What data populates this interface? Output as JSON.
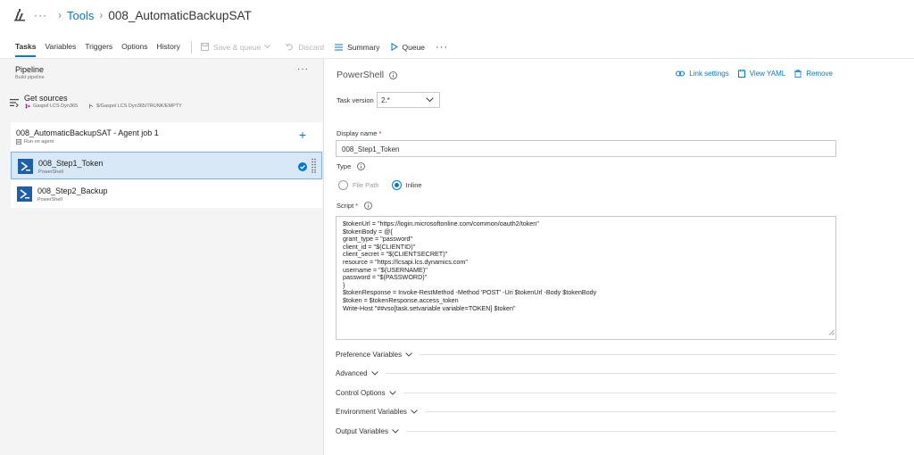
{
  "breadcrumb": {
    "logo_icon": "build-pipeline-icon",
    "ellipsis": "···",
    "parent": "Tools",
    "current": "008_AutomaticBackupSAT"
  },
  "toolbar": {
    "tabs": [
      "Tasks",
      "Variables",
      "Triggers",
      "Options",
      "History"
    ],
    "active_tab": "Tasks",
    "save_queue": "Save & queue",
    "discard": "Discard",
    "summary": "Summary",
    "queue": "Queue",
    "more": "···"
  },
  "pipeline": {
    "title": "Pipeline",
    "subtitle": "Build pipeline",
    "more": "···"
  },
  "get_sources": {
    "title": "Get sources",
    "repo": "Gaspol LCS Dyn365",
    "path": "$/Gaspol LCS Dyn365/TRUNK/EMPTY"
  },
  "agent_job": {
    "title": "008_AutomaticBackupSAT - Agent job 1",
    "subtitle": "Run on agent",
    "add": "+"
  },
  "tasks": [
    {
      "title": "008_Step1_Token",
      "subtitle": "PowerShell",
      "selected": true
    },
    {
      "title": "008_Step2_Backup",
      "subtitle": "PowerShell",
      "selected": false
    }
  ],
  "details": {
    "title": "PowerShell",
    "link_settings": "Link settings",
    "view_yaml": "View YAML",
    "remove": "Remove",
    "task_version_label": "Task version",
    "task_version_value": "2.*",
    "display_name_label": "Display name",
    "display_name_value": "008_Step1_Token",
    "type_label": "Type",
    "type_file_path": "File Path",
    "type_inline": "Inline",
    "script_label": "Script",
    "script_lines": [
      "$tokenUrl = \"https://login.microsoftonline.com/common/oauth2/token\"",
      "$tokenBody = @{",
      "grant_type = \"password\"",
      "client_id = \"$(CLIENTID)\"",
      "client_secret = \"$(CLIENTSECRET)\"",
      "resource = \"https://lcsapi.lcs.dynamics.com\"",
      "username = \"$(USERNAME)\"",
      "password = \"$(PASSWORD)\"",
      "}",
      "$tokenResponse = Invoke-RestMethod -Method 'POST' -Uri $tokenUrl -Body $tokenBody",
      "$token = $tokenResponse.access_token",
      "Write-Host \"##vso[task.setvariable variable=TOKEN] $token\""
    ],
    "sections": [
      "Preference Variables",
      "Advanced",
      "Control Options",
      "Environment Variables",
      "Output Variables"
    ]
  },
  "colors": {
    "accent": "#0078d4",
    "selected_bg": "#d9e8f7",
    "powershell_blue": "#1e5fa8",
    "panel_bg": "#f4f4f4",
    "required": "#a4262c"
  }
}
